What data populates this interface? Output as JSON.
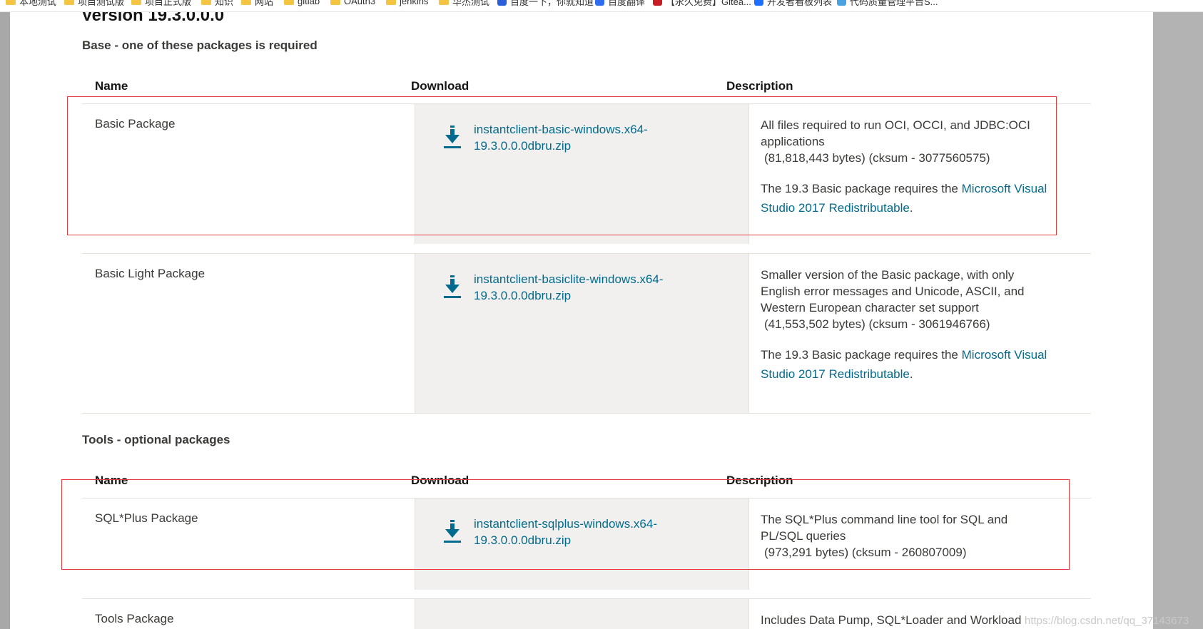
{
  "bookmarks": [
    {
      "label": "本地测试",
      "icon": "folder-icon"
    },
    {
      "label": "项目测试版",
      "icon": "folder-icon"
    },
    {
      "label": "项目正式版",
      "icon": "folder-icon"
    },
    {
      "label": "知识",
      "icon": "folder-icon"
    },
    {
      "label": "网站",
      "icon": "folder-icon"
    },
    {
      "label": "gitlab",
      "icon": "folder-icon"
    },
    {
      "label": "OAuth3",
      "icon": "folder-icon"
    },
    {
      "label": "jenkins",
      "icon": "folder-icon"
    },
    {
      "label": "华杰测试",
      "icon": "folder-icon"
    },
    {
      "label": "百度一下，你就知道",
      "icon": "baidu-icon"
    },
    {
      "label": "百度翻译",
      "icon": "translate-icon"
    },
    {
      "label": "【永久免费】Gitea...",
      "icon": "gitee-icon"
    },
    {
      "label": "开发者看板列表",
      "icon": "blue-icon"
    },
    {
      "label": "代码质量管理平台S...",
      "icon": "sonar-icon"
    }
  ],
  "version_heading": "Version 19.3.0.0.0",
  "base_section": {
    "title": "Base - one of these packages is required",
    "columns": {
      "name": "Name",
      "download": "Download",
      "description": "Description"
    },
    "rows": [
      {
        "name": "Basic Package",
        "link_line1": "instantclient-basic-windows.x64-",
        "link_line2": "19.3.0.0.0dbru.zip",
        "desc_line1": "All files required to run OCI, OCCI, and JDBC:OCI",
        "desc_line2": "applications",
        "size": "(81,818,443 bytes) (cksum - 3077560575)",
        "req_prefix": "The 19.3 Basic package requires the ",
        "req_link1": "Microsoft Visual",
        "req_link2": "Studio 2017 Redistributable",
        "req_suffix": "."
      },
      {
        "name": "Basic Light Package",
        "link_line1": "instantclient-basiclite-windows.x64-",
        "link_line2": "19.3.0.0.0dbru.zip",
        "desc_line1": "Smaller version of the Basic package, with only",
        "desc_line2": "English error messages and Unicode, ASCII, and",
        "desc_line3": "Western European character set support",
        "size": "(41,553,502 bytes) (cksum - 3061946766)",
        "req_prefix": "The 19.3 Basic package requires the ",
        "req_link1": "Microsoft Visual",
        "req_link2": "Studio 2017 Redistributable",
        "req_suffix": "."
      }
    ]
  },
  "tools_section": {
    "title": "Tools - optional packages",
    "columns": {
      "name": "Name",
      "download": "Download",
      "description": "Description"
    },
    "rows": [
      {
        "name": "SQL*Plus Package",
        "link_line1": "instantclient-sqlplus-windows.x64-",
        "link_line2": "19.3.0.0.0dbru.zip",
        "desc_line1": "The SQL*Plus command line tool for SQL and",
        "desc_line2": "PL/SQL queries",
        "size": "(973,291 bytes) (cksum - 260807009)"
      },
      {
        "name": "Tools Package",
        "desc_line1": "Includes Data Pump, SQL*Loader and Workload"
      }
    ]
  },
  "watermark": "https://blog.csdn.net/qq_37143673",
  "colors": {
    "link": "#006b8f",
    "highlight_box": "#e83a3a",
    "download_cell_bg": "#f1f0ee"
  }
}
